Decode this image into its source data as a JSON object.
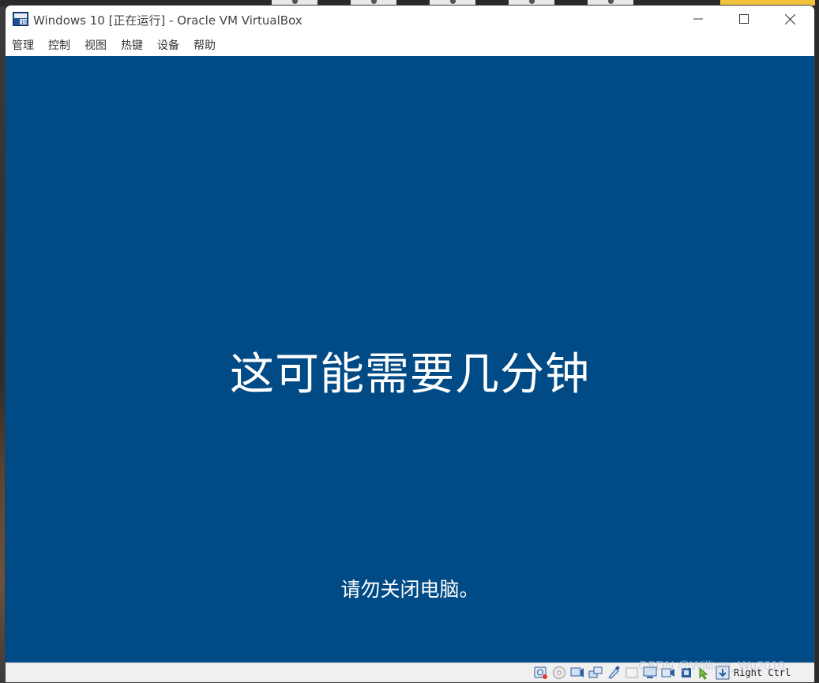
{
  "window": {
    "title": "Windows 10 [正在运行] - Oracle VM VirtualBox",
    "controls": {
      "minimize_icon": "minimize-icon",
      "maximize_icon": "maximize-icon",
      "close_icon": "close-icon"
    }
  },
  "menu": {
    "items": [
      "管理",
      "控制",
      "视图",
      "热键",
      "设备",
      "帮助"
    ]
  },
  "vm_screen": {
    "heading": "这可能需要几分钟",
    "subtext": "请勿关闭电脑。",
    "background_color": "#004a85"
  },
  "statusbar": {
    "icons": [
      "hard-disk-icon",
      "optical-drive-icon",
      "audio-icon",
      "network-icon",
      "usb-icon",
      "shared-folders-icon",
      "display-icon",
      "video-capture-icon",
      "cpu-icon",
      "mouse-integration-icon",
      "keyboard-capture-icon"
    ],
    "host_key": "Right Ctrl"
  },
  "watermark": "CSDN @William_Wu2010"
}
